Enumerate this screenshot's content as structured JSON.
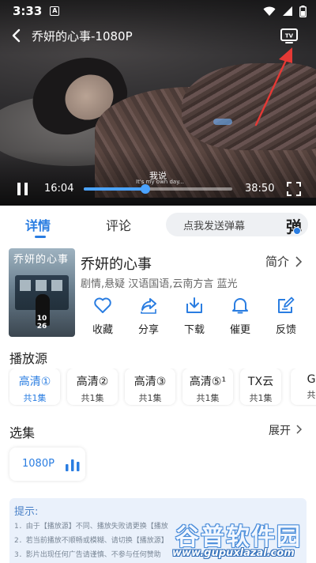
{
  "status_bar": {
    "time": "3:33",
    "notification_icon": "A"
  },
  "player": {
    "title": "乔妍的心事-1080P",
    "subtitle_line1": "我说",
    "subtitle_line2": "It's my own day...",
    "current_time": "16:04",
    "total_time": "38:50",
    "progress": 0.413,
    "accent_color": "#4ba3ff",
    "icons": [
      "back-arrow-icon",
      "tv-cast-icon",
      "pause-icon",
      "fullscreen-icon"
    ]
  },
  "tabs": {
    "detail": "详情",
    "comment": "评论",
    "danmaku_placeholder": "点我发送弹幕",
    "danmaku_icon": "弹"
  },
  "info": {
    "poster_title": "乔妍的心事",
    "poster_date": "10\n26",
    "title": "乔妍的心事",
    "intro_label": "简介",
    "meta": "剧情,悬疑 汉语国语,云南方言 蓝光",
    "actions": [
      {
        "label": "收藏",
        "icon": "heart-icon"
      },
      {
        "label": "分享",
        "icon": "share-icon"
      },
      {
        "label": "下载",
        "icon": "download-icon"
      },
      {
        "label": "催更",
        "icon": "bell-icon"
      },
      {
        "label": "反馈",
        "icon": "feedback-icon"
      }
    ]
  },
  "sources": {
    "title": "播放源",
    "items": [
      {
        "name": "高清①",
        "count": "共1集",
        "active": true
      },
      {
        "name": "高清②",
        "count": "共1集",
        "active": false
      },
      {
        "name": "高清③",
        "count": "共1集",
        "active": false
      },
      {
        "name": "高清⑤¹",
        "count": "共1集",
        "active": false
      },
      {
        "name": "TX云",
        "count": "共1集",
        "active": false
      },
      {
        "name": "G",
        "count": "共",
        "active": false
      }
    ]
  },
  "episodes": {
    "title": "选集",
    "expand_label": "展开",
    "items": [
      {
        "label": "1080P",
        "playing": true
      }
    ]
  },
  "tips": {
    "title": "提示:",
    "lines": [
      "1．由于【播放源】不同、播放失败请更换【播放",
      "2．若当前播放不顺畅或模糊、请切换【播放源】",
      "3．影片出现任何广告请谨慎、不参与任何赞助"
    ]
  },
  "watermark": {
    "text": "谷普软件园",
    "url": "www.gupuxlazal.com"
  },
  "colors": {
    "accent": "#2a7de1",
    "tip_bg": "#eaf1fb",
    "annotation_arrow": "#e53935"
  }
}
